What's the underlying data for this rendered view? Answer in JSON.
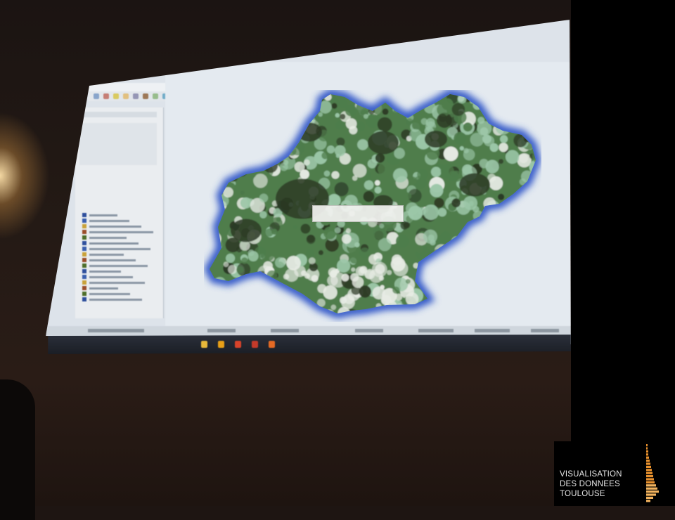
{
  "projected_app": {
    "titlebar": "",
    "toolbar_icon_colors": [
      "#3f6fb0",
      "#e0a126",
      "#5b9b3e",
      "#b84a3a",
      "#6e6e9a",
      "#3a8fb7",
      "#d6c23a",
      "#8a5a2e"
    ],
    "layer_swatch_colors": [
      "#2e4f9c",
      "#3a5fae",
      "#c9a23a",
      "#9a4d2a",
      "#4e6e2a"
    ],
    "map_feature_tooltip": "",
    "region_colors": {
      "dense": "#2c3a24",
      "mid": "#4f7d4c",
      "light": "#9cc7a8",
      "pale": "#e7ebe4",
      "halo": "#2d54c7"
    },
    "taskbar_item_colors": [
      "#e8b93a",
      "#e9a017",
      "#d9432a",
      "#c43a2a",
      "#e56a24"
    ]
  },
  "logo": {
    "lines": [
      "VISUALISATION",
      "DES DONNEES",
      "TOULOUSE"
    ],
    "bar_color": "#e8912e",
    "bar_color_light": "#f2b35e"
  }
}
